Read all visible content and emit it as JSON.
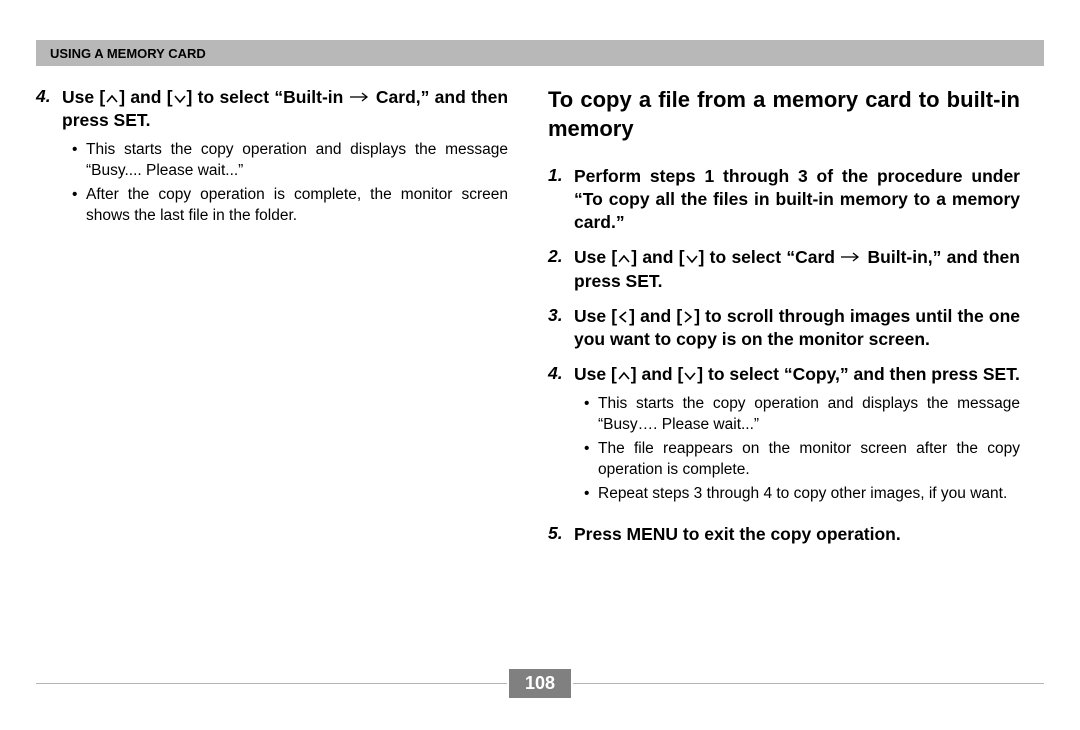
{
  "header": {
    "title": "USING A MEMORY CARD"
  },
  "left": {
    "step4": {
      "num": "4.",
      "text_p1": "Use [",
      "text_p2": "] and [",
      "text_p3": "] to select “Built-in",
      "text_p4": "Card,” and then press SET.",
      "bullets": [
        "This starts the copy operation and displays the message “Busy.... Please wait...”",
        "After the copy operation is complete, the monitor screen shows the last file in the folder."
      ]
    }
  },
  "right": {
    "title": "To copy a file from a memory card to built-in memory",
    "step1": {
      "num": "1.",
      "text": "Perform steps 1 through 3 of the procedure under “To copy all the files in built-in memory to a memory card.”"
    },
    "step2": {
      "num": "2.",
      "text_p1": "Use [",
      "text_p2": "] and [",
      "text_p3": "] to select “Card",
      "text_p4": "Built-in,” and then press SET."
    },
    "step3": {
      "num": "3.",
      "text_p1": "Use [",
      "text_p2": "] and [",
      "text_p3": "] to scroll through images until the one you want to copy is on the monitor screen."
    },
    "step4": {
      "num": "4.",
      "text_p1": "Use [",
      "text_p2": "] and [",
      "text_p3": "] to select “Copy,” and then press SET.",
      "bullets": [
        "This starts the copy operation and displays the message “Busy…. Please wait...”",
        "The file reappears on the monitor screen after the copy operation is complete.",
        "Repeat steps 3 through 4 to copy other images, if you want."
      ]
    },
    "step5": {
      "num": "5.",
      "text": "Press MENU to exit the copy operation."
    }
  },
  "page_number": "108"
}
